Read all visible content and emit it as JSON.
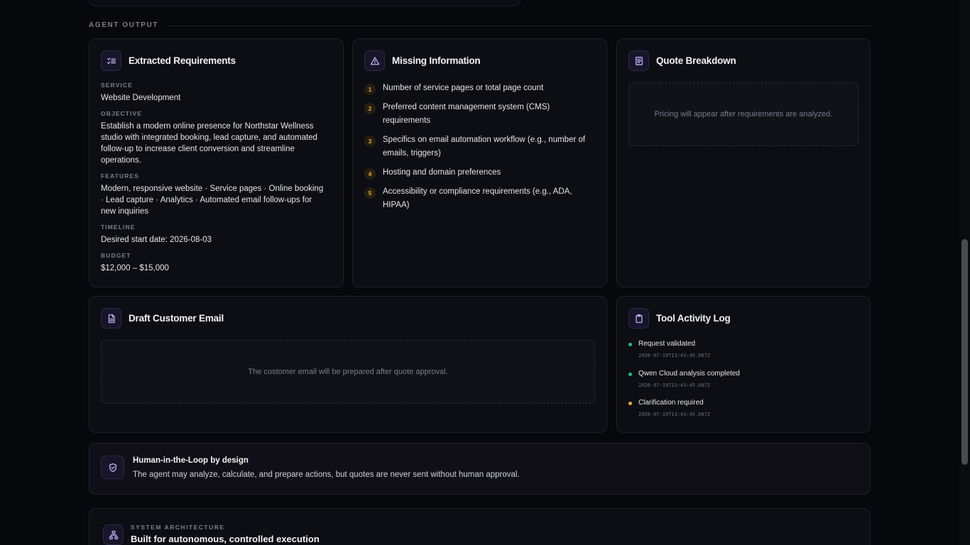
{
  "section": {
    "label": "AGENT OUTPUT"
  },
  "requirements": {
    "title": "Extracted Requirements",
    "icon": "list-check-icon",
    "fields": [
      {
        "label": "SERVICE",
        "value": "Website Development"
      },
      {
        "label": "OBJECTIVE",
        "value": "Establish a modern online presence for Northstar Wellness studio with integrated booking, lead capture, and automated follow-up to increase client conversion and streamline operations."
      },
      {
        "label": "FEATURES",
        "value": "Modern, responsive website · Service pages · Online booking · Lead capture · Analytics · Automated email follow-ups for new inquiries"
      },
      {
        "label": "TIMELINE",
        "value": "Desired start date: 2026-08-03"
      },
      {
        "label": "BUDGET",
        "value": "$12,000 – $15,000"
      }
    ]
  },
  "missing": {
    "title": "Missing Information",
    "icon": "alert-triangle-icon",
    "items": [
      {
        "num": "1",
        "text": "Number of service pages or total page count"
      },
      {
        "num": "2",
        "text": "Preferred content management system (CMS) requirements"
      },
      {
        "num": "3",
        "text": "Specifics on email automation workflow (e.g., number of emails, triggers)"
      },
      {
        "num": "4",
        "text": "Hosting and domain preferences"
      },
      {
        "num": "5",
        "text": "Accessibility or compliance requirements (e.g., ADA, HIPAA)"
      }
    ]
  },
  "quote": {
    "title": "Quote Breakdown",
    "icon": "receipt-icon",
    "placeholder": "Pricing will appear after requirements are analyzed."
  },
  "email": {
    "title": "Draft Customer Email",
    "icon": "document-icon",
    "placeholder": "The customer email will be prepared after quote approval."
  },
  "log": {
    "title": "Tool Activity Log",
    "icon": "clipboard-icon",
    "items": [
      {
        "title": "Request validated",
        "time": "2026-07-19T13:43:45.687Z",
        "status_color": "#22c08a"
      },
      {
        "title": "Qwen Cloud analysis completed",
        "time": "2026-07-19T13:43:45.687Z",
        "status_color": "#22c08a"
      },
      {
        "title": "Clarification required",
        "time": "2026-07-19T13:43:45.687Z",
        "status_color": "#f0a928"
      }
    ]
  },
  "hitl": {
    "icon": "shield-check-icon",
    "title": "Human-in-the-Loop by design",
    "text": "The agent may analyze, calculate, and prepare actions, but quotes are never sent without human approval."
  },
  "architecture": {
    "icon": "network-icon",
    "label": "SYSTEM ARCHITECTURE",
    "title": "Built for autonomous, controlled execution"
  },
  "colors": {
    "accent": "#b5a8ec",
    "background": "#07080b",
    "card": "#0d0e13",
    "warning": "#e0a63a",
    "success": "#22c08a"
  }
}
